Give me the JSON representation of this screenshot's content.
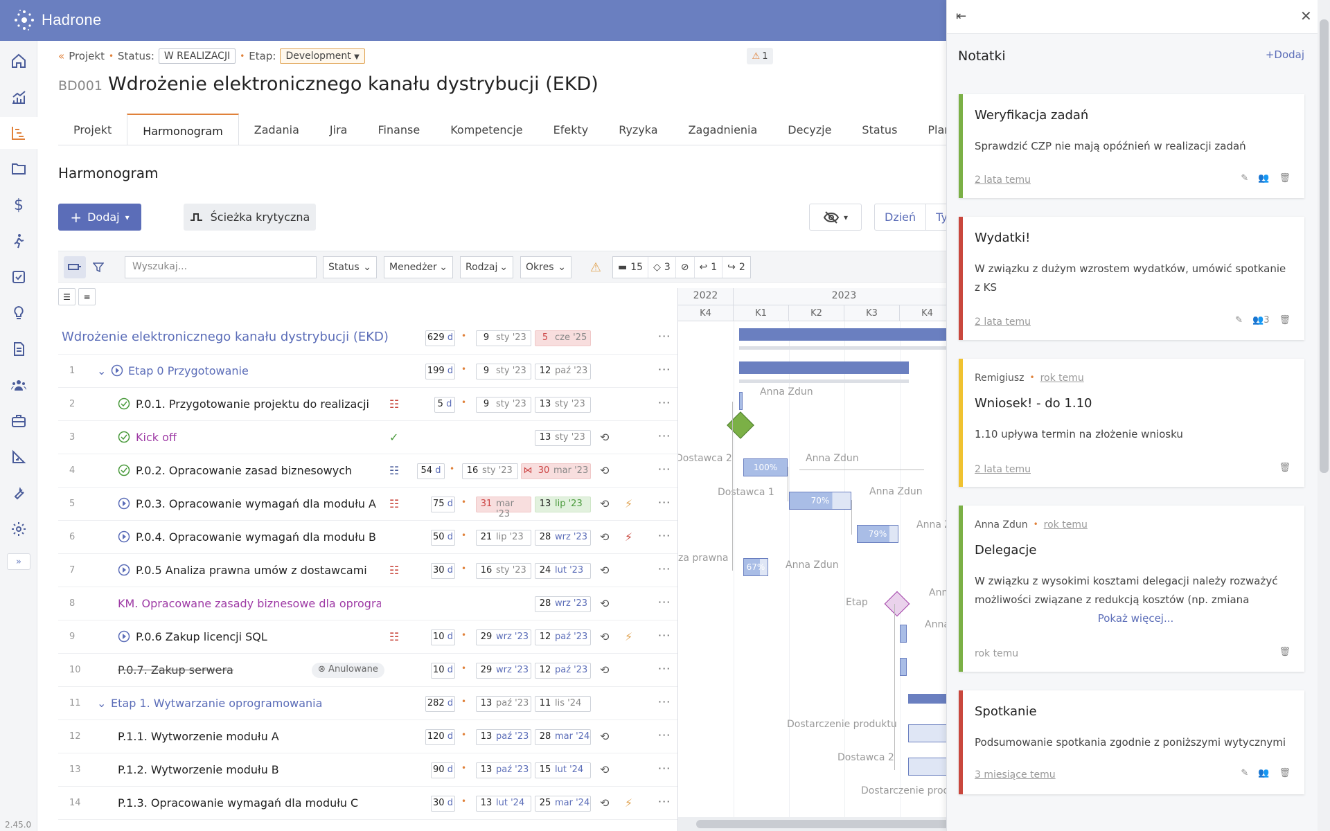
{
  "app": {
    "name": "Hadrone",
    "version": "2.45.0"
  },
  "breadcrumb": {
    "project_label": "Projekt",
    "status_label": "Status:",
    "status_value": "W REALIZACJI",
    "stage_label": "Etap:",
    "stage_value": "Development",
    "warning_count": "1"
  },
  "project": {
    "code": "BD001",
    "name": "Wdrożenie elektronicznego kanału dystrybucji (EKD)"
  },
  "tabs": [
    "Projekt",
    "Harmonogram",
    "Zadania",
    "Jira",
    "Finanse",
    "Kompetencje",
    "Efekty",
    "Ryzyka",
    "Zagadnienia",
    "Decyzje",
    "Status",
    "Plan bazowy"
  ],
  "section": {
    "title": "Harmonogram"
  },
  "actions": {
    "add_label": "Dodaj",
    "critical_path_label": "Ścieżka krytyczna",
    "view_day": "Dzień",
    "view_week": "Tyd"
  },
  "filters": {
    "search_placeholder": "Wyszukaj...",
    "status": "Status",
    "manager": "Menedżer",
    "kind": "Rodzaj",
    "period": "Okres",
    "count_tasks": "15",
    "count_milestones": "3",
    "count_back": "1",
    "count_forward": "2"
  },
  "gantt": {
    "years": [
      "2022",
      "2023"
    ],
    "quarters": [
      "K4",
      "K1",
      "K2",
      "K3",
      "K4"
    ],
    "bar_labels": [
      "100%",
      "70%",
      "79%",
      "67%"
    ],
    "labels": [
      "Anna Zdun",
      "Dostawca 2",
      "Anna Zdun",
      "Dostawca 1",
      "Anna Zdun",
      "Anna Z",
      "za prawna",
      "Anna Zdun",
      "Etap",
      "Ann",
      "Anna",
      "Dostarczenie produktu",
      "Dostawca 2",
      "Dostarczenie produ"
    ]
  },
  "rows": [
    {
      "num": "",
      "name": "Wdrożenie elektronicznego kanału dystrybucji (EKD)",
      "dur": "629",
      "du": "d",
      "s_d": "9",
      "s_m": "sty '23",
      "e_d": "5",
      "e_m": "cze '25"
    },
    {
      "num": "1",
      "name": "Etap 0 Przygotowanie",
      "dur": "199",
      "du": "d",
      "s_d": "9",
      "s_m": "sty '23",
      "e_d": "12",
      "e_m": "paź '23"
    },
    {
      "num": "2",
      "name": "P.0.1. Przygotowanie projektu do realizacji",
      "dur": "5",
      "du": "d",
      "s_d": "9",
      "s_m": "sty '23",
      "e_d": "13",
      "e_m": "sty '23"
    },
    {
      "num": "3",
      "name": "Kick off",
      "e_d": "13",
      "e_m": "sty '23"
    },
    {
      "num": "4",
      "name": "P.0.2. Opracowanie zasad biznesowych",
      "dur": "54",
      "du": "d",
      "s_d": "16",
      "s_m": "sty '23",
      "e_d": "30",
      "e_m": "mar '23"
    },
    {
      "num": "5",
      "name": "P.0.3. Opracowanie wymagań dla modułu A",
      "dur": "75",
      "du": "d",
      "s_d": "31",
      "s_m": "mar '23",
      "e_d": "13",
      "e_m": "lip '23"
    },
    {
      "num": "6",
      "name": "P.0.4. Opracowanie wymagań dla modułu B",
      "dur": "50",
      "du": "d",
      "s_d": "21",
      "s_m": "lip '23",
      "e_d": "28",
      "e_m": "wrz '23"
    },
    {
      "num": "7",
      "name": "P.0.5 Analiza prawna umów z dostawcami",
      "dur": "30",
      "du": "d",
      "s_d": "16",
      "s_m": "sty '23",
      "e_d": "24",
      "e_m": "lut '23"
    },
    {
      "num": "8",
      "name": "KM. Opracowane zasady biznesowe dla oprogram...",
      "e_d": "28",
      "e_m": "wrz '23"
    },
    {
      "num": "9",
      "name": "P.0.6 Zakup licencji SQL",
      "dur": "10",
      "du": "d",
      "s_d": "29",
      "s_m": "wrz '23",
      "e_d": "12",
      "e_m": "paź '23"
    },
    {
      "num": "10",
      "name": "P.0.7. Zakup serwera",
      "badge": "Anulowane",
      "dur": "10",
      "du": "d",
      "s_d": "29",
      "s_m": "wrz '23",
      "e_d": "12",
      "e_m": "paź '23"
    },
    {
      "num": "11",
      "name": "Etap 1. Wytwarzanie oprogramowania",
      "dur": "282",
      "du": "d",
      "s_d": "13",
      "s_m": "paź '23",
      "e_d": "11",
      "e_m": "lis '24"
    },
    {
      "num": "12",
      "name": "P.1.1. Wytworzenie modułu A",
      "dur": "120",
      "du": "d",
      "s_d": "13",
      "s_m": "paź '23",
      "e_d": "28",
      "e_m": "mar '24"
    },
    {
      "num": "13",
      "name": "P.1.2. Wytworzenie modułu B",
      "dur": "90",
      "du": "d",
      "s_d": "13",
      "s_m": "paź '23",
      "e_d": "15",
      "e_m": "lut '24"
    },
    {
      "num": "14",
      "name": "P.1.3. Opracowanie wymagań dla modułu C",
      "dur": "30",
      "du": "d",
      "s_d": "13",
      "s_m": "lut '24",
      "e_d": "25",
      "e_m": "mar '24"
    }
  ],
  "notes": {
    "title": "Notatki",
    "add_label": "Dodaj",
    "items": [
      {
        "title": "Weryfikacja zadań",
        "body": "Sprawdzić CZP nie mają opóźnień w realizacji zadań",
        "date": "2 lata temu",
        "color": "#7bb046"
      },
      {
        "title": "Wydatki!",
        "body": "W związku z dużym wzrostem wydatków, umówić spotkanie z KS",
        "date": "2 lata temu",
        "members": "3",
        "color": "#c9473d"
      },
      {
        "author": "Remigiusz",
        "ago": "rok temu",
        "title": "Wniosek! - do 1.10",
        "body": "1.10 upływa termin na złożenie wniosku",
        "date": "2 lata temu",
        "color": "#f0c230"
      },
      {
        "author": "Anna Zdun",
        "ago": "rok temu",
        "title": "Delegacje",
        "body": "W związku z wysokimi kosztami delegacji należy rozważyć możliwości związane z redukcją kosztów (np. zmiana",
        "more": "Pokaż więcej...",
        "date": "rok temu",
        "color": "#7bb046"
      },
      {
        "title": "Spotkanie",
        "body": "Podsumowanie spotkania zgodnie z poniższymi wytycznymi",
        "date": "3 miesiące temu",
        "color": "#c9473d"
      }
    ]
  }
}
